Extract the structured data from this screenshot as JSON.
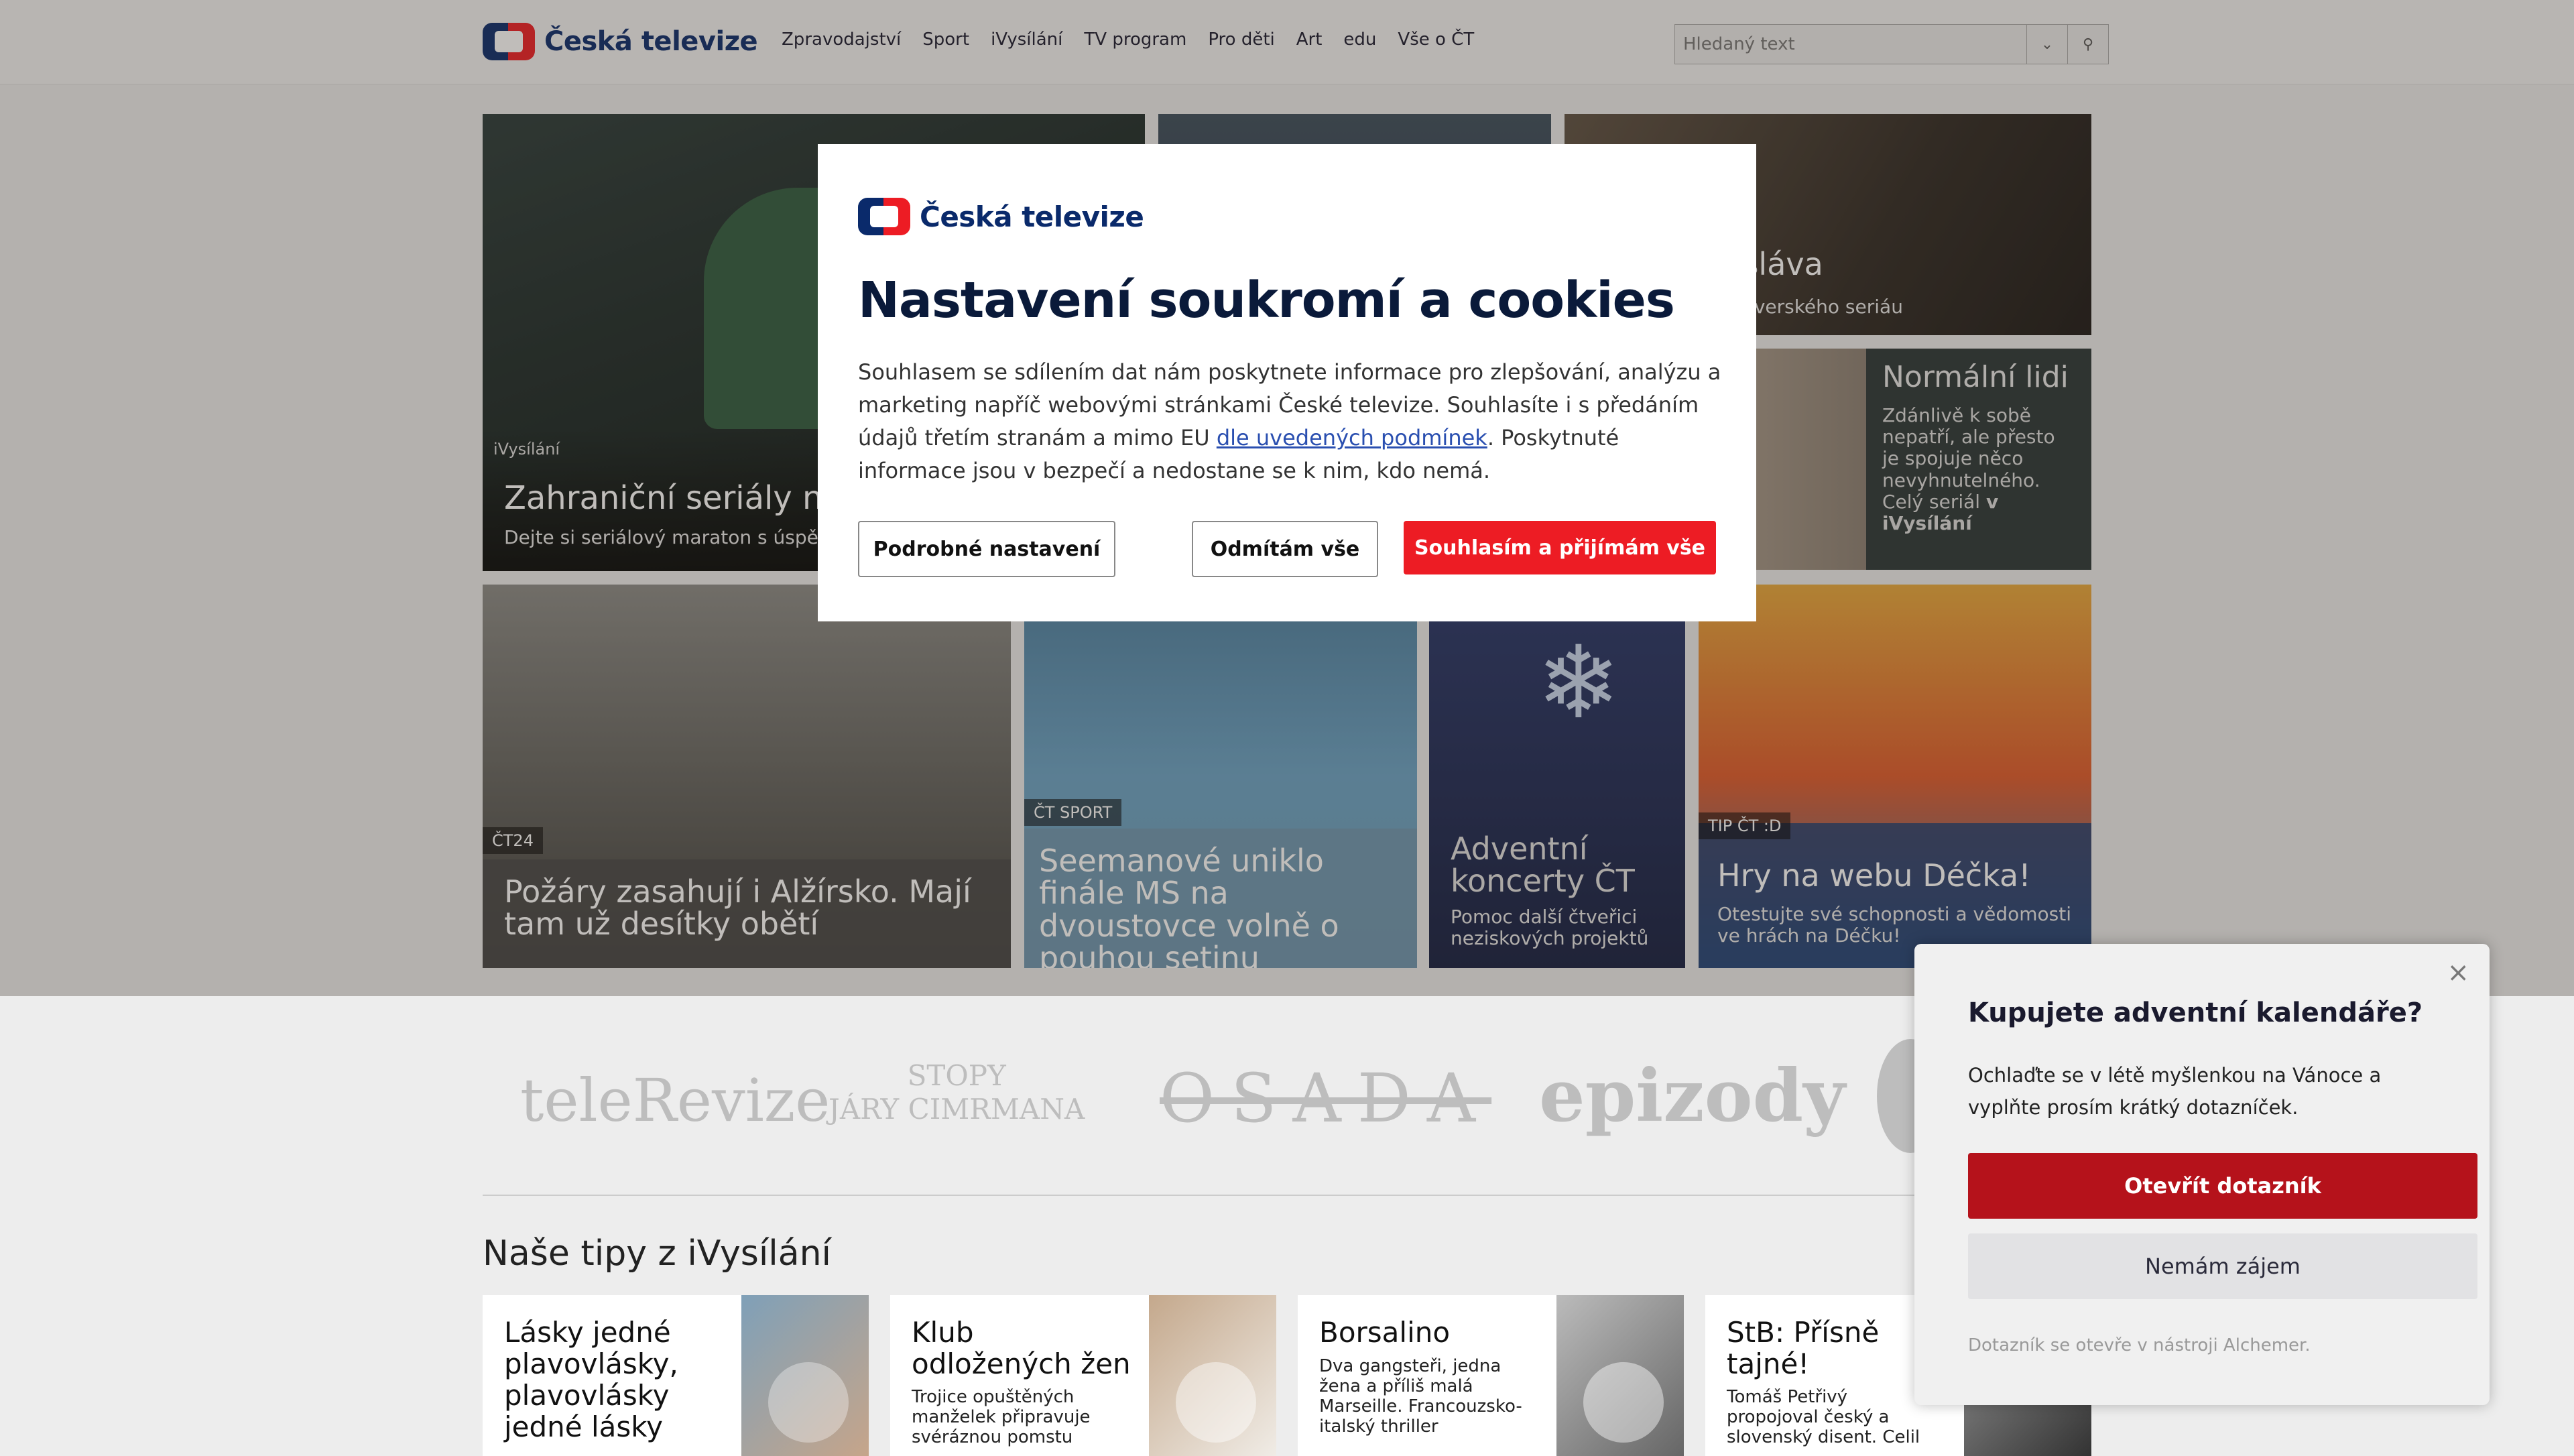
{
  "header": {
    "brand": "Česká televize",
    "nav": [
      "Zpravodajství",
      "Sport",
      "iVysílání",
      "TV program",
      "Pro děti",
      "Art",
      "edu",
      "Vše o ČT"
    ],
    "search_placeholder": "Hledaný text"
  },
  "hero": {
    "tile1": {
      "label": "iVysílání",
      "title": "Zahraniční seriály na",
      "sub": "Dejte si seriálový maraton s úspě"
    },
    "tile3": {
      "title": "t a sláva",
      "sub": "ého severského seriáu"
    },
    "tile4": {
      "title": "Normální lidi",
      "sub": "Zdánlivě k sobě nepatří, ale přesto je spojuje něco nevyhnutelného. Celý seriál",
      "sub_bold": "v iVysílání"
    },
    "tile5": {
      "label": "ČT24",
      "title": "Požáry zasahují i Alžírsko. Mají tam už desítky obětí"
    },
    "tile6": {
      "label": "ČT SPORT",
      "title": "Seemanové uniklo finále MS na dvoustovce volně o pouhou setinu"
    },
    "tile7": {
      "title": "Adventní koncerty ČT",
      "sub": "Pomoc další čtveřici neziskových projektů"
    },
    "tile8": {
      "label": "TIP ČT :D",
      "title": "Hry na webu Déčka!",
      "sub": "Otestujte své schopnosti a vědomosti ve hrách na Déčku!"
    }
  },
  "brands": [
    "teleRevize",
    "STOPY",
    "JÁRY CIMRMANA",
    "OSADA",
    "epizody"
  ],
  "tips": {
    "heading": "Naše tipy z iVysílání",
    "cards": [
      {
        "title": "Lásky jedné plavovlásky, plavovlásky jedné lásky",
        "sub": ""
      },
      {
        "title": "Klub odložených žen",
        "sub": "Trojice opuštěných manželek připravuje svéráznou pomstu"
      },
      {
        "title": "Borsalino",
        "sub": "Dva gangsteři, jedna žena a příliš malá Marseille. Francouzsko-italský thriller"
      },
      {
        "title": "StB: Přísně tajné!",
        "sub": "Tomáš Petřivý propojoval český a slovenský disent. Celil"
      }
    ]
  },
  "modal": {
    "brand": "Česká televize",
    "title": "Nastavení soukromí a cookies",
    "text_before": "Souhlasem se sdílením dat nám poskytnete informace pro zlepšování, analýzu a marketing napříč webovými stránkami České televize. Souhlasíte i s předáním údajů třetím stranám a mimo EU ",
    "link": "dle uvedených podmínek",
    "text_after": ". Poskytnuté informace jsou v bezpečí a nedostane se k nim, kdo nemá.",
    "btn_details": "Podrobné nastavení",
    "btn_reject": "Odmítám vše",
    "btn_accept": "Souhlasím a přijímám vše"
  },
  "survey": {
    "title": "Kupujete adventní kalendáře?",
    "text": "Ochlaďte se v létě myšlenkou na Vánoce a vyplňte prosím krátký dotazníček.",
    "btn_open": "Otevřít dotazník",
    "btn_no": "Nemám zájem",
    "footer": "Dotazník se otevře v nástroji Alchemer.",
    "close": "×"
  },
  "colors": {
    "accent_red": "#ed1c24",
    "brand_blue": "#0a2a6b",
    "survey_red": "#b5121b"
  }
}
